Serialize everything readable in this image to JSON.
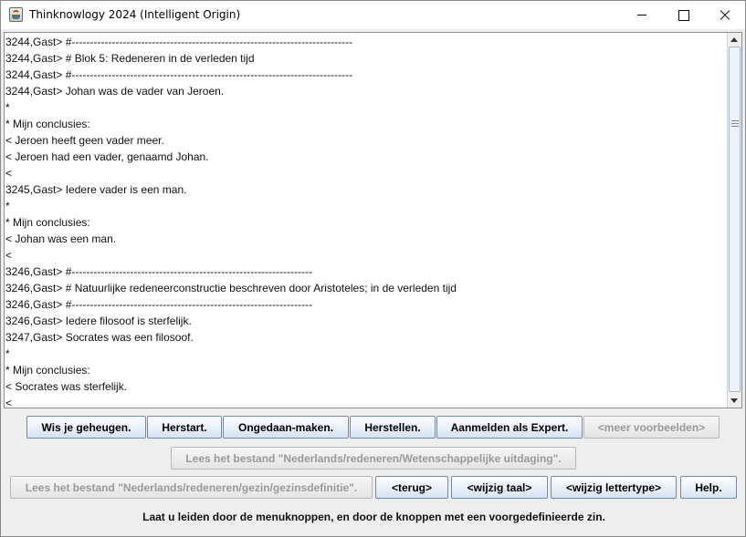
{
  "window": {
    "title": "Thinknowlogy 2024 (Intelligent Origin)"
  },
  "log": [
    "3244,Gast> #-----------------------------------------------------------------------------",
    "3244,Gast> # Blok 5: Redeneren in de verleden tijd",
    "3244,Gast> #-----------------------------------------------------------------------------",
    "3244,Gast> Johan was de vader van Jeroen.",
    "*",
    "* Mijn conclusies:",
    "< Jeroen heeft geen vader meer.",
    "< Jeroen had een vader, genaamd Johan.",
    "<",
    "3245,Gast> Iedere vader is een man.",
    "*",
    "* Mijn conclusies:",
    "< Johan was een man.",
    "<",
    "3246,Gast> #------------------------------------------------------------------",
    "3246,Gast> # Natuurlijke redeneerconstructie beschreven door Aristoteles; in de verleden tijd",
    "3246,Gast> #------------------------------------------------------------------",
    "3246,Gast> Iedere filosoof is sterfelijk.",
    "3247,Gast> Socrates was een filosoof.",
    "*",
    "* Mijn conclusies:",
    "< Socrates was sterfelijk.",
    "<"
  ],
  "buttons": {
    "row1": {
      "clear_memory": "Wis je geheugen.",
      "restart": "Herstart.",
      "undo": "Ongedaan-maken.",
      "redo": "Herstellen.",
      "login_expert": "Aanmelden als Expert.",
      "more_examples": "<meer voorbeelden>"
    },
    "row2": {
      "read_file_challenge": "Lees het bestand \"Nederlands/redeneren/Wetenschappelijke uitdaging\"."
    },
    "row3": {
      "read_file_family": "Lees het bestand \"Nederlands/redeneren/gezin/gezinsdefinitie\".",
      "back": "<terug>",
      "change_language": "<wijzig taal>",
      "change_font": "<wijzig lettertype>",
      "help": "Help."
    }
  },
  "status": "Laat u leiden door de menuknoppen, en door de knoppen met een voorgedefinieerde zin."
}
